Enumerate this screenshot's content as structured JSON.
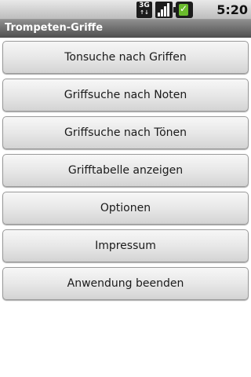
{
  "status_bar": {
    "network_label": "3G",
    "icons": [
      "network-3g-icon",
      "signal-strength-icon",
      "battery-charging-icon"
    ],
    "time": "5:20 PM"
  },
  "app": {
    "title": "Trompeten-Griffe"
  },
  "menu": {
    "items": [
      {
        "label": "Tonsuche nach Griffen"
      },
      {
        "label": "Griffsuche nach Noten"
      },
      {
        "label": "Griffsuche nach Tönen"
      },
      {
        "label": "Grifftabelle anzeigen"
      },
      {
        "label": "Optionen"
      },
      {
        "label": "Impressum"
      },
      {
        "label": "Anwendung beenden"
      }
    ]
  },
  "colors": {
    "titlebar": "#5a5a5a",
    "button": "#e6e6e6",
    "background": "#ffffff"
  }
}
